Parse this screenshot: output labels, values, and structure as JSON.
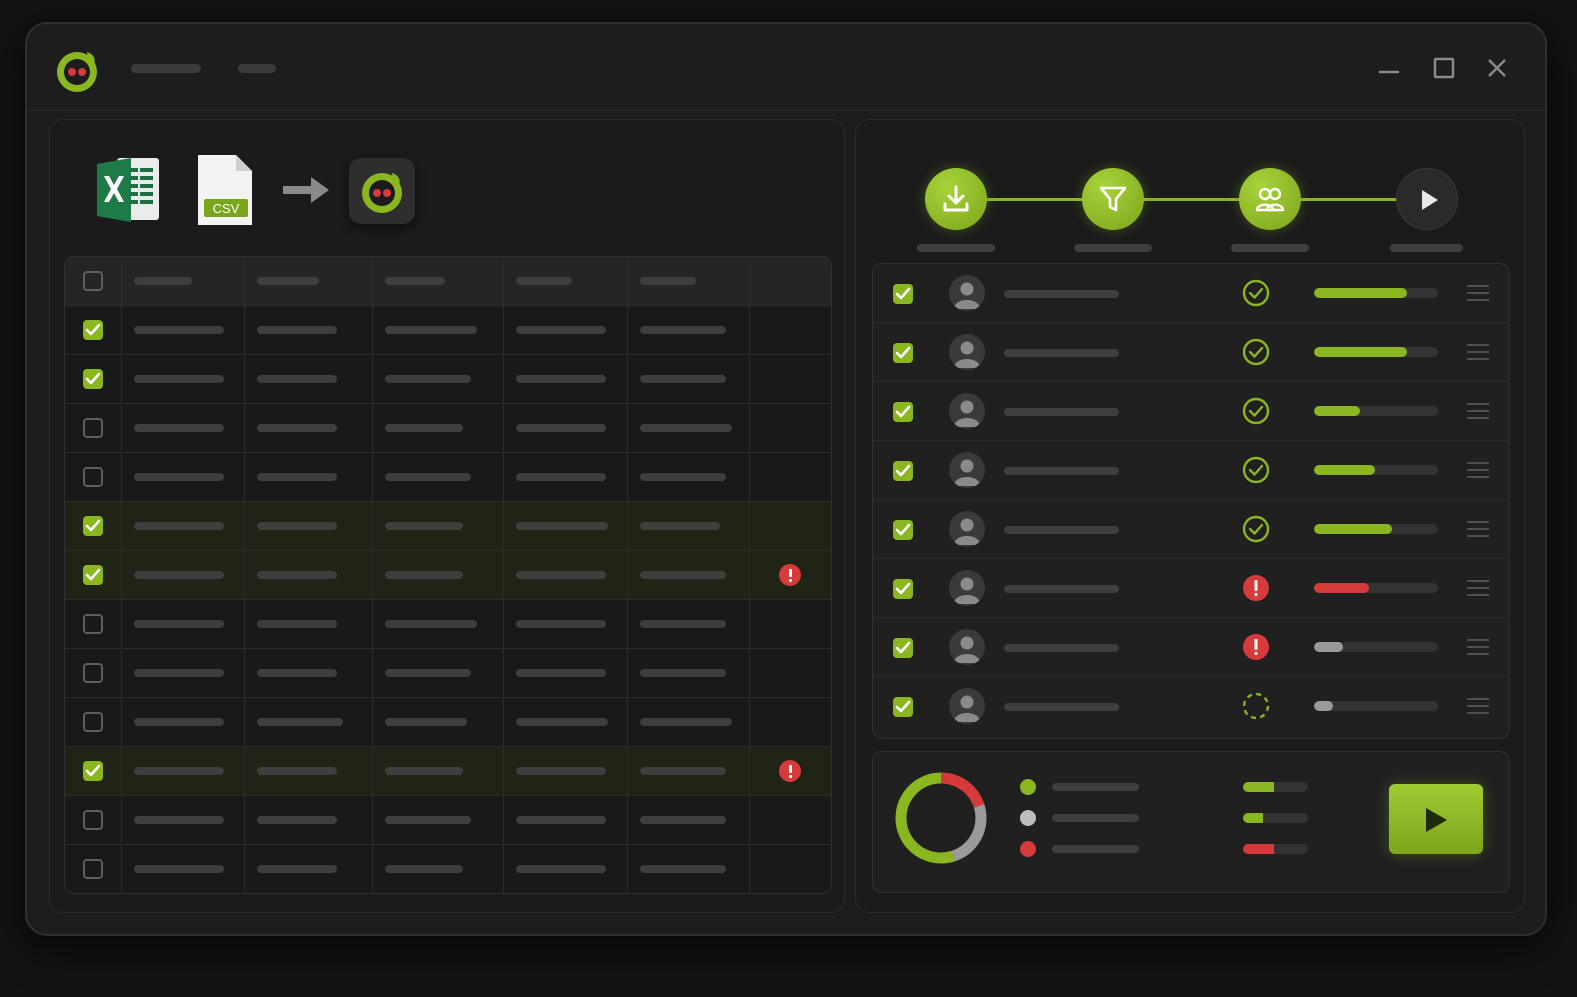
{
  "app": {
    "name": "",
    "logo_icon": "app-logo-icon",
    "accent": "#8ab61f",
    "error": "#d73a3a"
  },
  "window_controls": {
    "minimize_icon": "minimize-icon",
    "maximize_icon": "maximize-icon",
    "close_icon": "close-icon"
  },
  "import": {
    "sources": [
      "excel-file-icon",
      "csv-file-icon"
    ],
    "csv_label": "CSV",
    "arrow_icon": "arrow-right-icon",
    "target": "app-logo-icon"
  },
  "grid": {
    "header_checked": false,
    "rows": [
      {
        "checked": true,
        "highlighted": false,
        "error": false
      },
      {
        "checked": true,
        "highlighted": false,
        "error": false
      },
      {
        "checked": false,
        "highlighted": false,
        "error": false
      },
      {
        "checked": false,
        "highlighted": false,
        "error": false
      },
      {
        "checked": true,
        "highlighted": true,
        "error": false
      },
      {
        "checked": true,
        "highlighted": true,
        "error": true
      },
      {
        "checked": false,
        "highlighted": false,
        "error": false
      },
      {
        "checked": false,
        "highlighted": false,
        "error": false
      },
      {
        "checked": false,
        "highlighted": false,
        "error": false
      },
      {
        "checked": true,
        "highlighted": true,
        "error": true
      },
      {
        "checked": false,
        "highlighted": false,
        "error": false
      },
      {
        "checked": false,
        "highlighted": false,
        "error": false
      }
    ]
  },
  "steps": [
    {
      "icon": "download-icon",
      "state": "done"
    },
    {
      "icon": "filter-icon",
      "state": "done"
    },
    {
      "icon": "users-icon",
      "state": "done"
    },
    {
      "icon": "play-icon",
      "state": "pending"
    }
  ],
  "contacts": [
    {
      "checked": true,
      "status": "success",
      "progress": 0.75,
      "bar": "green"
    },
    {
      "checked": true,
      "status": "success",
      "progress": 0.75,
      "bar": "green"
    },
    {
      "checked": true,
      "status": "success",
      "progress": 0.37,
      "bar": "green"
    },
    {
      "checked": true,
      "status": "success",
      "progress": 0.49,
      "bar": "green"
    },
    {
      "checked": true,
      "status": "success",
      "progress": 0.63,
      "bar": "green"
    },
    {
      "checked": true,
      "status": "error",
      "progress": 0.44,
      "bar": "red"
    },
    {
      "checked": true,
      "status": "error",
      "progress": 0.23,
      "bar": "gray"
    },
    {
      "checked": true,
      "status": "pending",
      "progress": 0.15,
      "bar": "gray"
    }
  ],
  "summary": {
    "donut": {
      "green": 0.55,
      "gray": 0.25,
      "red": 0.2
    },
    "legend": [
      {
        "color": "#8ab61f",
        "bar_fill": 0.48
      },
      {
        "color": "#bdbdbd",
        "bar_fill": 0.3
      },
      {
        "color": "#d73a3a",
        "bar_fill": 0.48
      }
    ],
    "run_icon": "play-icon"
  }
}
